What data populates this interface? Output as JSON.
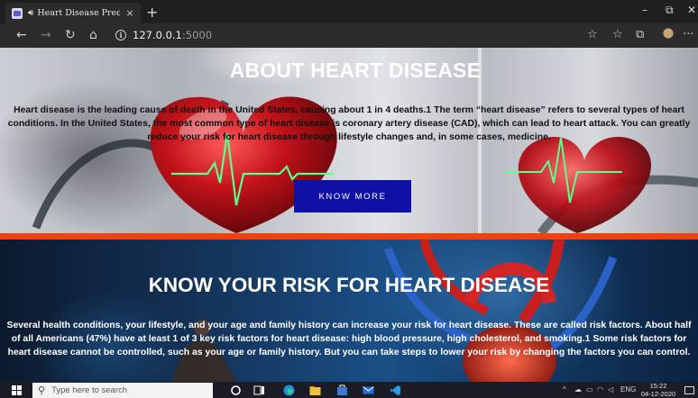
{
  "browser": {
    "tab": {
      "title": "Heart Disease Prediction Sy",
      "audio_icon": "speaker-icon",
      "close_glyph": "×"
    },
    "new_tab_glyph": "+",
    "window_controls": {
      "minimize": "–",
      "restore": "⧉",
      "close": "✕"
    },
    "nav": {
      "back": "←",
      "forward": "→",
      "refresh": "↻",
      "home": "⌂"
    },
    "address": {
      "host": "127.0.0.1",
      "port": ":5000"
    },
    "toolbar": {
      "favorite": "☆",
      "favorites_bar": "☆",
      "collections": "⧉",
      "more": "···"
    }
  },
  "hero": {
    "title": "ABOUT HEART DISEASE",
    "text": "Heart disease is the leading cause of death in the United States, causing about 1 in 4 deaths.1 The term “heart disease” refers to several types of heart conditions. In the United States, the most common type of heart disease is coronary artery disease (CAD), which can lead to heart attack. You can greatly reduce your risk for heart disease through lifestyle changes and, in some cases, medicine.",
    "button_label": "KNOW MORE",
    "button_color": "#0e10a6",
    "divider_color": "#f2410c"
  },
  "risk": {
    "title": "KNOW YOUR RISK FOR HEART DISEASE",
    "text": "Several health conditions, your lifestyle, and your age and family history can increase your risk for heart disease. These are called risk factors. About half of all Americans (47%) have at least 1 of 3 key risk factors for heart disease: high blood pressure, high cholesterol, and smoking.1 Some risk factors for heart disease cannot be controlled, such as your age or family history. But you can take steps to lower your risk by changing the factors you can control."
  },
  "taskbar": {
    "search_placeholder": "Type here to search",
    "tray": {
      "expand": "^",
      "language": "ENG",
      "time": "15:22",
      "date": "04-12-2020"
    }
  }
}
